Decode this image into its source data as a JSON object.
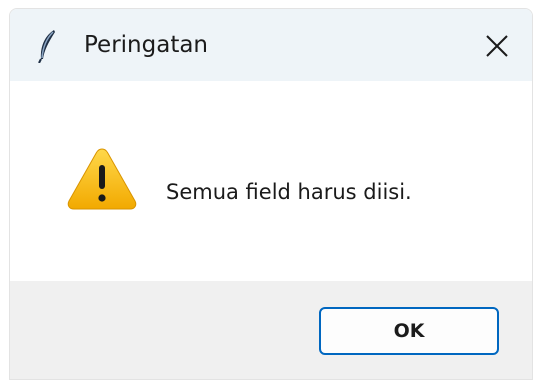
{
  "window": {
    "title": "Peringatan",
    "app_icon": "feather-icon",
    "close_icon": "close-icon"
  },
  "dialog": {
    "icon": "warning-icon",
    "message": "Semua field harus diisi.",
    "ok_label": "OK"
  },
  "colors": {
    "titlebar_bg": "#eef4f8",
    "footer_bg": "#f0f0f0",
    "ok_border": "#0067c0",
    "warning_yellow": "#f7c02c"
  }
}
